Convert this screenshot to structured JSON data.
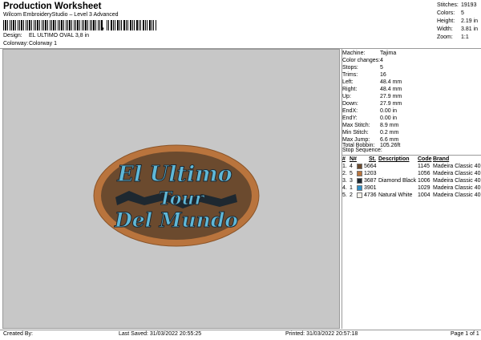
{
  "header": {
    "title": "Production Worksheet",
    "subtitle": "Wilcom EmbroideryStudio – Level 3 Advanced",
    "barcode_mark": ","
  },
  "meta": [
    {
      "label": "Design:",
      "value": "EL ULTIMO OVAL 3,8 in"
    },
    {
      "label": "Colorway:",
      "value": "Colorway 1"
    }
  ],
  "top_stats": [
    {
      "label": "Stitches:",
      "value": "19193"
    },
    {
      "label": "Colors:",
      "value": "5"
    },
    {
      "label": "Height:",
      "value": "2.19 in"
    },
    {
      "label": "Width:",
      "value": "3.81 in"
    },
    {
      "label": "Zoom:",
      "value": "1:1"
    }
  ],
  "machine_info": [
    {
      "label": "Machine:",
      "value": "Tajima"
    },
    {
      "label": "Color changes:",
      "value": "4"
    },
    {
      "label": "Stops:",
      "value": "5"
    },
    {
      "label": "Trims:",
      "value": "16"
    },
    {
      "label": "Left:",
      "value": "48.4 mm"
    },
    {
      "label": "Right:",
      "value": "48.4 mm"
    },
    {
      "label": "Up:",
      "value": "27.9 mm"
    },
    {
      "label": "Down:",
      "value": "27.9 mm"
    },
    {
      "label": "EndX:",
      "value": "0.00 in"
    },
    {
      "label": "EndY:",
      "value": "0.00 in"
    },
    {
      "label": "Max Stitch:",
      "value": "8.9 mm"
    },
    {
      "label": "Min Stitch:",
      "value": "0.2 mm"
    },
    {
      "label": "Max Jump:",
      "value": "6.6 mm"
    },
    {
      "label": "Total Bobbin:",
      "value": "105.26ft"
    }
  ],
  "stop_sequence": {
    "title": "Stop Sequence:",
    "headers": [
      "#",
      "N#",
      "St.",
      "Description",
      "Code",
      "Brand"
    ],
    "rows": [
      {
        "num": "1.",
        "n": "4",
        "color": "#6b4a2e",
        "st": "5664",
        "desc": "",
        "code": "1145",
        "brand": "Madeira Classic 40"
      },
      {
        "num": "2.",
        "n": "5",
        "color": "#b9743d",
        "st": "1203",
        "desc": "",
        "code": "1056",
        "brand": "Madeira Classic 40"
      },
      {
        "num": "3.",
        "n": "3",
        "color": "#1e2830",
        "st": "3687",
        "desc": "Diamond Black",
        "code": "1006",
        "brand": "Madeira Classic 40"
      },
      {
        "num": "4.",
        "n": "1",
        "color": "#2f8fc7",
        "st": "3901",
        "desc": "",
        "code": "1029",
        "brand": "Madeira Classic 40"
      },
      {
        "num": "5.",
        "n": "2",
        "color": "#f4f1ea",
        "st": "4736",
        "desc": "Natural White",
        "code": "1004",
        "brand": "Madeira Classic 40"
      }
    ]
  },
  "design_text": {
    "line1": "El Ultimo",
    "line2": "Tour",
    "line3": "Del Mundo"
  },
  "footer": {
    "created_by": "Created By:",
    "last_saved": "Last Saved: 31/03/2022 20:55:25",
    "printed": "Printed: 31/03/2022 20:57:18",
    "page": "Page 1 of 1"
  }
}
